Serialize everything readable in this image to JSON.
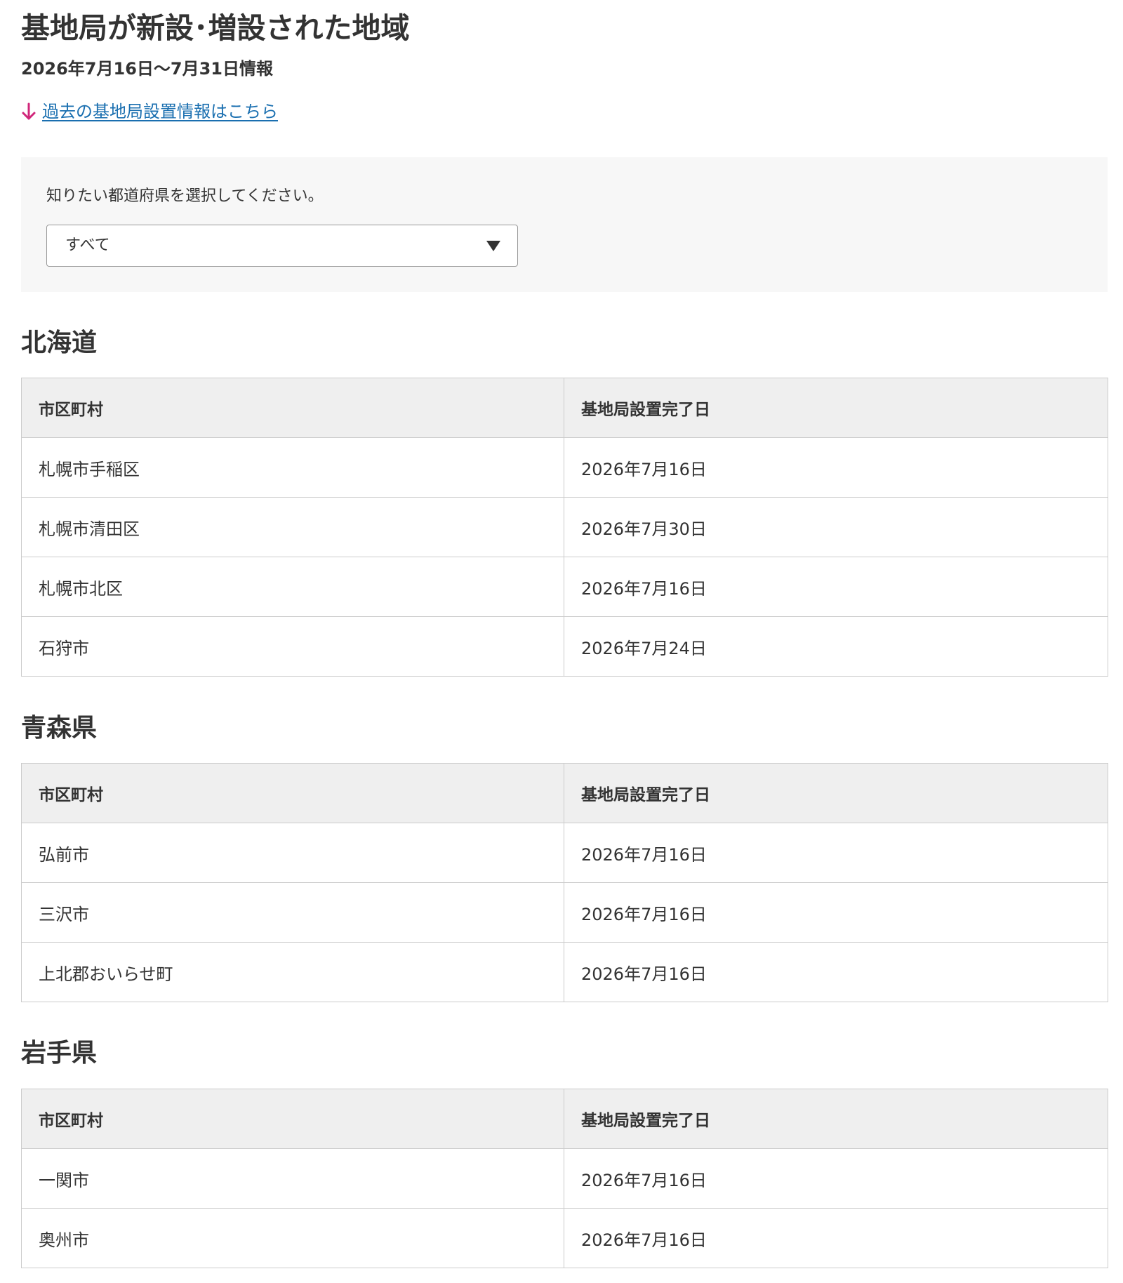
{
  "header": {
    "title": "基地局が新設･増設された地域",
    "period": "2026年7月16日〜7月31日情報",
    "past_link": "過去の基地局設置情報はこちら"
  },
  "filter": {
    "label": "知りたい都道府県を選択してください。",
    "selected": "すべて"
  },
  "table_headers": {
    "city": "市区町村",
    "date": "基地局設置完了日"
  },
  "sections": [
    {
      "prefecture": "北海道",
      "rows": [
        {
          "city": "札幌市手稲区",
          "date": "2026年7月16日"
        },
        {
          "city": "札幌市清田区",
          "date": "2026年7月30日"
        },
        {
          "city": "札幌市北区",
          "date": "2026年7月16日"
        },
        {
          "city": "石狩市",
          "date": "2026年7月24日"
        }
      ]
    },
    {
      "prefecture": "青森県",
      "rows": [
        {
          "city": "弘前市",
          "date": "2026年7月16日"
        },
        {
          "city": "三沢市",
          "date": "2026年7月16日"
        },
        {
          "city": "上北郡おいらせ町",
          "date": "2026年7月16日"
        }
      ]
    },
    {
      "prefecture": "岩手県",
      "rows": [
        {
          "city": "一関市",
          "date": "2026年7月16日"
        },
        {
          "city": "奥州市",
          "date": "2026年7月16日"
        }
      ]
    }
  ],
  "colors": {
    "link": "#1a6fb0",
    "arrow_accent": "#d0267a",
    "panel_bg": "#f7f7f7",
    "table_header_bg": "#efefef",
    "border": "#cccccc"
  },
  "icons": {
    "link_arrow": "arrow-down-icon",
    "select_caret": "caret-down-icon"
  }
}
